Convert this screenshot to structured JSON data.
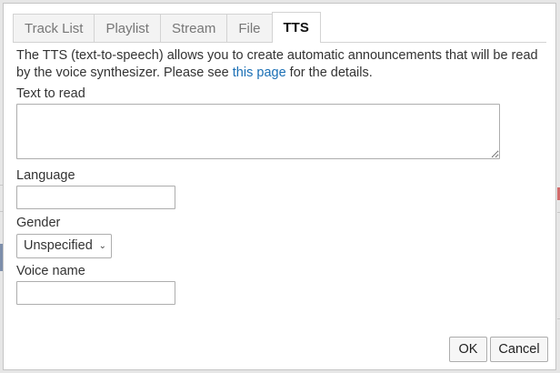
{
  "tabs": [
    {
      "label": "Track List",
      "active": false
    },
    {
      "label": "Playlist",
      "active": false
    },
    {
      "label": "Stream",
      "active": false
    },
    {
      "label": "File",
      "active": false
    },
    {
      "label": "TTS",
      "active": true
    }
  ],
  "intro": {
    "before": "The TTS (text-to-speech) allows you to create automatic announcements that will be read by the voice synthesizer. Please see ",
    "link": "this page",
    "after": " for the details."
  },
  "fields": {
    "text_label": "Text to read",
    "text_value": "",
    "language_label": "Language",
    "language_value": "",
    "gender_label": "Gender",
    "gender_value": "Unspecified",
    "voice_label": "Voice name",
    "voice_value": ""
  },
  "buttons": {
    "ok": "OK",
    "cancel": "Cancel"
  },
  "colors": {
    "link": "#1a6fb5",
    "active_tab_bg": "#ffffff",
    "inactive_tab_bg": "#f3f3f3"
  }
}
